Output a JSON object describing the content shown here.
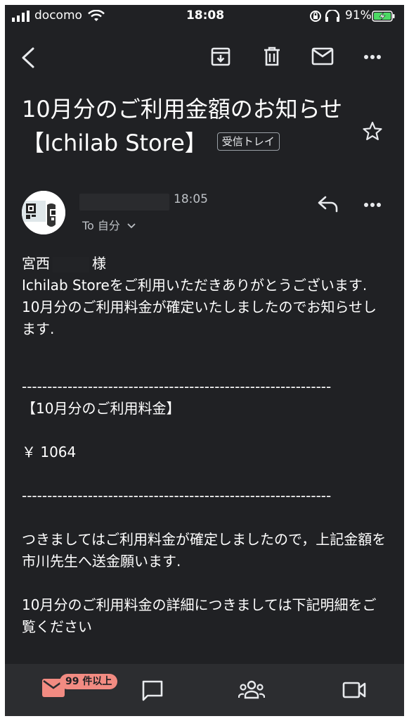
{
  "status_bar": {
    "carrier": "docomo",
    "time": "18:08",
    "battery_percent": "91%"
  },
  "toolbar": {
    "icons": [
      "back-icon",
      "archive-icon",
      "trash-icon",
      "mail-icon",
      "more-icon"
    ]
  },
  "email": {
    "subject": "10月分のご利用金額のお知らせ　【Ichilab Store】",
    "label": "受信トレイ",
    "sender_time": "18:05",
    "to_line": "To 自分",
    "body": {
      "greeting_prefix": "宮西",
      "greeting_suffix": "様",
      "line1": "Ichilab Storeをご利用いただきありがとうございます.",
      "line2": "10月分のご利用料金が確定いたしましたのでお知らせします.",
      "divider": "-------------------------------------------------------------",
      "section_title": "【10月分のご利用料金】",
      "amount": "￥ 1064",
      "line3": "つきましてはご利用料金が確定しましたので，上記金額を市川先生へ送金願います.",
      "line4": "10月分のご利用料金の詳細につきましては下記明細をご覧ください"
    }
  },
  "bottom_nav": {
    "badge": "99 件以上",
    "icons": [
      "mail-icon",
      "chat-icon",
      "spaces-icon",
      "meet-icon"
    ]
  },
  "colors": {
    "background": "#202124",
    "badge": "#f28b82",
    "nav_bar": "#2c2d30"
  }
}
